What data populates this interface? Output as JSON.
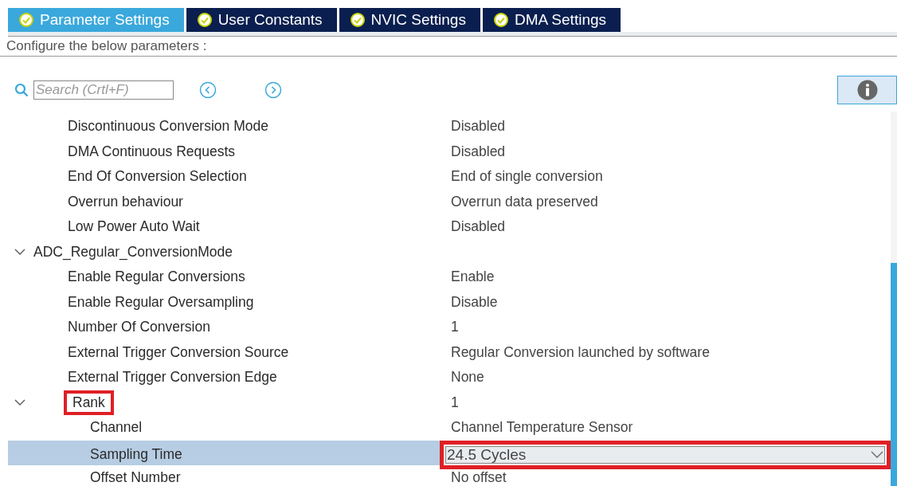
{
  "tabs": [
    {
      "label": "Parameter Settings",
      "selected": true
    },
    {
      "label": "User Constants",
      "selected": false
    },
    {
      "label": "NVIC Settings",
      "selected": false
    },
    {
      "label": "DMA Settings",
      "selected": false
    }
  ],
  "heading": "Configure the below parameters :",
  "search": {
    "placeholder": "Search (Crtl+F)"
  },
  "parameters": [
    {
      "label": "Discontinuous Conversion Mode",
      "value": "Disabled"
    },
    {
      "label": "DMA Continuous Requests",
      "value": "Disabled"
    },
    {
      "label": "End Of Conversion Selection",
      "value": "End of single conversion"
    },
    {
      "label": "Overrun behaviour",
      "value": "Overrun data preserved"
    },
    {
      "label": "Low Power Auto Wait",
      "value": "Disabled"
    }
  ],
  "groups": [
    {
      "label": "ADC_Regular_ConversionMode",
      "expanded": true,
      "children": [
        {
          "label": "Enable Regular Conversions",
          "value": "Enable"
        },
        {
          "label": "Enable Regular Oversampling",
          "value": "Disable"
        },
        {
          "label": "Number Of Conversion",
          "value": "1"
        },
        {
          "label": "External Trigger Conversion Source",
          "value": "Regular Conversion launched by software"
        },
        {
          "label": "External Trigger Conversion Edge",
          "value": "None"
        },
        {
          "label": "Rank",
          "value": "1",
          "expanded": true,
          "marked": true,
          "children": [
            {
              "label": "Channel",
              "value": "Channel Temperature Sensor"
            },
            {
              "label": "Sampling Time",
              "value": "24.5 Cycles",
              "kind": "dropdown",
              "selected": true,
              "marked": true
            },
            {
              "label": "Offset Number",
              "value": "No offset"
            }
          ]
        }
      ]
    }
  ]
}
